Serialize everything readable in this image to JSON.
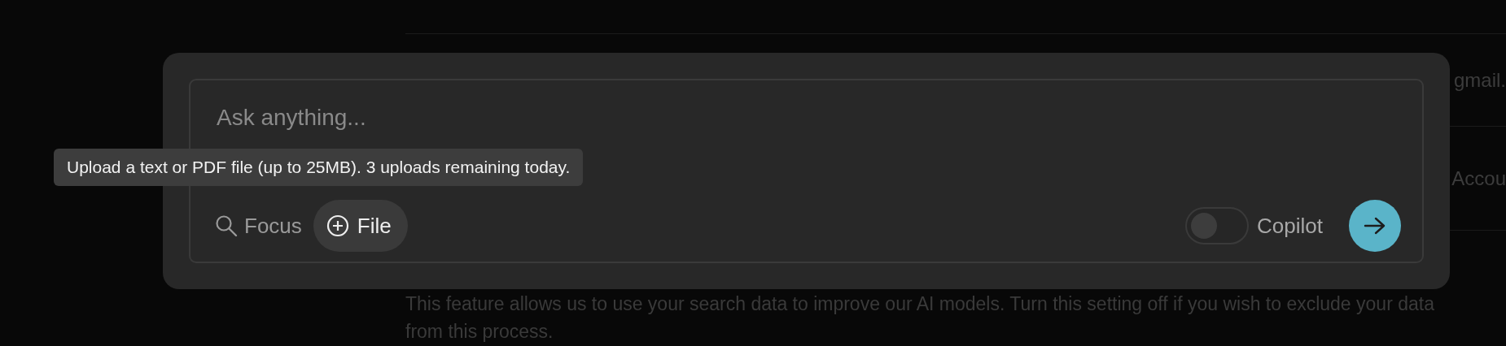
{
  "background": {
    "email_fragment": "gmail.",
    "account_fragment": "Accou",
    "description": "This feature allows us to use your search data to improve our AI models. Turn this setting off if you wish to exclude your data from this process."
  },
  "composer": {
    "placeholder": "Ask anything...",
    "focus_label": "Focus",
    "file_label": "File",
    "file_hovered": true,
    "copilot": {
      "label": "Copilot",
      "on": false
    }
  },
  "tooltip": "Upload a text or PDF file (up to 25MB). 3 uploads remaining today."
}
